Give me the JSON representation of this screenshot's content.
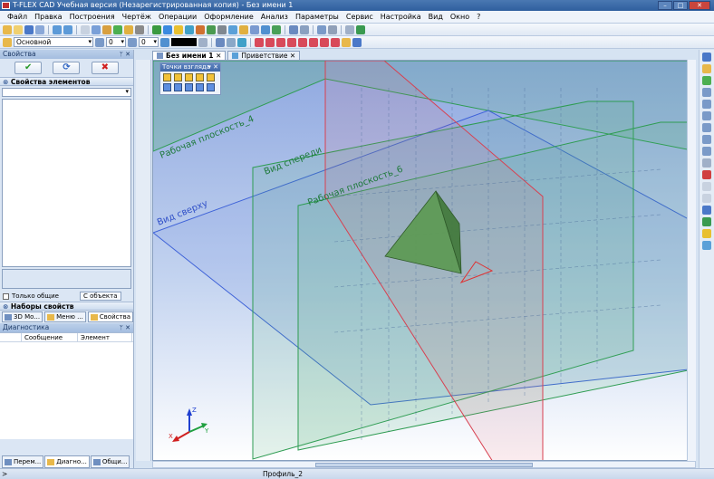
{
  "window": {
    "title": "T-FLEX CAD Учебная версия (Незарегистрированная копия) - Без имени 1"
  },
  "menu": [
    {
      "label": "Файл"
    },
    {
      "label": "Правка"
    },
    {
      "label": "Построения"
    },
    {
      "label": "Чертёж"
    },
    {
      "label": "Операции"
    },
    {
      "label": "Оформление"
    },
    {
      "label": "Анализ"
    },
    {
      "label": "Параметры"
    },
    {
      "label": "Сервис"
    },
    {
      "label": "Настройка"
    },
    {
      "label": "Вид"
    },
    {
      "label": "Окно"
    },
    {
      "label": "?"
    }
  ],
  "toolbar2": {
    "layer": "Основной",
    "level": "0",
    "priority": "0",
    "color_swatch": "#000000"
  },
  "properties_panel": {
    "title": "Свойства",
    "ok_icon": "check-icon",
    "refresh_icon": "refresh-icon",
    "cancel_icon": "cross-icon",
    "elements_section": "Свойства элементов",
    "only_common_label": "Только общие",
    "by_object_button": "С объекта",
    "property_sets_section": "Наборы свойств",
    "tabs": [
      {
        "label": "3D Мо..."
      },
      {
        "label": "Меню ..."
      },
      {
        "label": "Свойства"
      }
    ]
  },
  "diagnostics_panel": {
    "title": "Диагностика",
    "columns": [
      "Сообщение",
      "Элемент"
    ]
  },
  "bottom_tabs": [
    {
      "label": "Перем..."
    },
    {
      "label": "Диагно..."
    },
    {
      "label": "Общи..."
    }
  ],
  "document_tabs": [
    {
      "label": "Без имени 1 ✕",
      "active": true
    },
    {
      "label": "Приветствие ✕",
      "active": false
    }
  ],
  "view_points_panel": {
    "title": "Точки взгляда"
  },
  "scene": {
    "plane_labels": {
      "plane_4": "Рабочая плоскость_4",
      "front": "Вид спереди",
      "plane_6": "Рабочая плоскость_6",
      "top": "Вид сверху"
    },
    "axes": {
      "x": "X",
      "y": "Y",
      "z": "Z"
    },
    "colors": {
      "green_plane": "#2e9c52",
      "blue_plane": "#3e62d8",
      "red_plane": "#d84050",
      "solid": "#4f8f4a"
    }
  },
  "status": {
    "left": ">",
    "profile": "Профиль_2"
  }
}
